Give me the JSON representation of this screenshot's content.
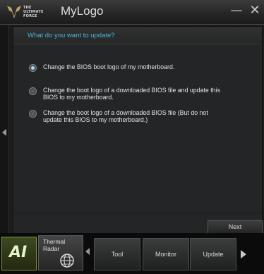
{
  "window": {
    "title": "MyLogo",
    "brand_line1": "THE",
    "brand_line2": "ULTIMATE",
    "brand_line3": "FORCE",
    "minimize_icon": "minimize-icon",
    "close_icon": "close-icon"
  },
  "main": {
    "question": "What do you want to update?",
    "options": [
      {
        "label": "Change the BIOS boot logo of my motherboard.",
        "checked": true
      },
      {
        "label": "Change the boot logo of a downloaded BIOS file and update this BIOS to my motherboard.",
        "checked": false
      },
      {
        "label": "Change the boot logo of a downloaded BIOS file (But do not update this BIOS to my motherboard.)",
        "checked": false
      }
    ],
    "next_label": "Next"
  },
  "dock": {
    "ai_logo": "AI",
    "thermal_line1": "Thermal",
    "thermal_line2": "Radar",
    "buttons": [
      "Tool",
      "Monitor",
      "Update"
    ]
  },
  "colors": {
    "accent": "#4fb3d9",
    "dock_accent": "#7f9a3a"
  }
}
